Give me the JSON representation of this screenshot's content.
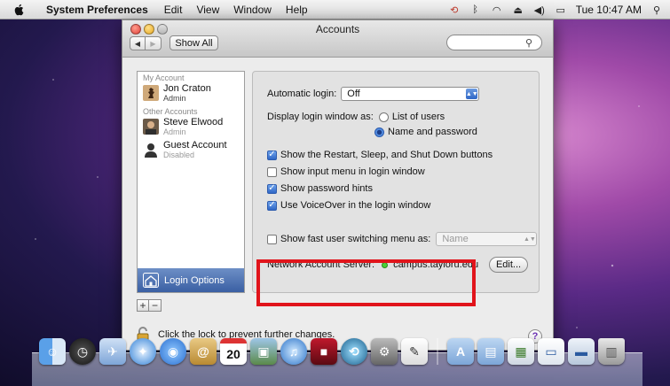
{
  "menubar": {
    "app_name": "System Preferences",
    "items": [
      "Edit",
      "View",
      "Window",
      "Help"
    ],
    "clock": "Tue 10:47 AM"
  },
  "window": {
    "title": "Accounts",
    "show_all_label": "Show All",
    "search_placeholder": ""
  },
  "accounts": {
    "my_account_heading": "My Account",
    "other_accounts_heading": "Other Accounts",
    "items": [
      {
        "name": "Jon Craton",
        "role": "Admin",
        "icon": "chess-piece-avatar-icon"
      },
      {
        "name": "Steve Elwood",
        "role": "Admin",
        "icon": "user-photo-avatar-icon"
      },
      {
        "name": "Guest Account",
        "role": "Disabled",
        "icon": "guest-silhouette-icon"
      }
    ],
    "login_options_label": "Login Options",
    "add_label": "+",
    "remove_label": "−"
  },
  "login_options": {
    "automatic_login_label": "Automatic login:",
    "automatic_login_value": "Off",
    "display_login_label": "Display login window as:",
    "radio_list_users": "List of users",
    "radio_name_password": "Name and password",
    "radio_selected": "Name and password",
    "checkboxes": [
      {
        "label": "Show the Restart, Sleep, and Shut Down buttons",
        "checked": true
      },
      {
        "label": "Show input menu in login window",
        "checked": false
      },
      {
        "label": "Show password hints",
        "checked": true
      },
      {
        "label": "Use VoiceOver in the login window",
        "checked": true
      }
    ],
    "fast_switch_label": "Show fast user switching menu as:",
    "fast_switch_checked": false,
    "fast_switch_value": "Name",
    "network_server_label": "Network Account Server:",
    "network_server_value": "campus.tayloru.edu",
    "network_status_color": "#4cd137",
    "edit_label": "Edit..."
  },
  "footer": {
    "lock_text": "Click the lock to prevent further changes.",
    "help_label": "?"
  },
  "dock": {
    "calendar_day": "20"
  },
  "colors": {
    "highlight_border": "#e1141b",
    "selection_blue": "#3a5fa3"
  }
}
